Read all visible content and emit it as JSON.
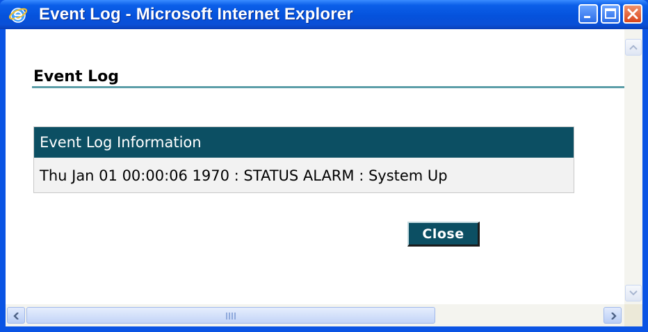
{
  "window": {
    "title": "Event Log - Microsoft Internet Explorer",
    "icon": "internet-explorer-icon"
  },
  "page": {
    "title": "Event Log"
  },
  "table": {
    "header": "Event Log Information",
    "rows": [
      "Thu Jan 01 00:00:06 1970 : STATUS ALARM : System Up"
    ]
  },
  "actions": {
    "close_label": "Close"
  },
  "colors": {
    "header_bg": "#0c4f63",
    "button_bg": "#0c4f63",
    "rule": "#5c9ea8",
    "titlebar": "#0552dc"
  }
}
